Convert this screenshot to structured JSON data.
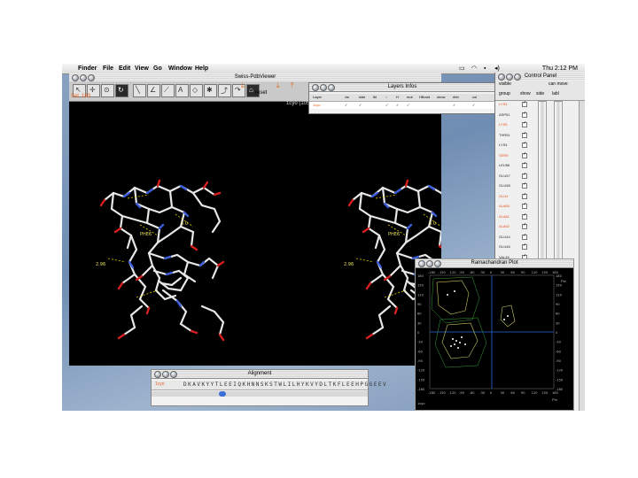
{
  "menubar": {
    "app": "Finder",
    "items": [
      "File",
      "Edit",
      "View",
      "Go",
      "Window",
      "Help"
    ],
    "clock": "Thu 2:12 PM"
  },
  "main_window": {
    "title": "Swiss-PdbViewer",
    "selection_label": "Sel. 183",
    "reset_label": "reset",
    "structure_title": "1cyo (1053 x 863)"
  },
  "layers_window": {
    "title": "Layers Infos",
    "columns": [
      "Layer",
      "vis",
      "side",
      "lbl",
      "::",
      "H",
      "mot",
      "HBond",
      "show",
      "ribb",
      "col"
    ],
    "row": [
      "1cyo",
      "✓",
      "✓",
      "",
      "✓",
      "✓",
      "✓",
      "",
      "",
      "✓",
      "✓"
    ]
  },
  "control_panel": {
    "title": "Control Panel",
    "group_label": "group",
    "visible_label": "visible",
    "can_move_label": "can move",
    "show_label": "show",
    "side_label": "side",
    "labl_label": "labl",
    "residues": [
      "LYS4",
      "ASP51",
      "LYS5",
      "THR51",
      "LYS4",
      "SER5",
      "LEU56",
      "GLU57",
      "GLU58",
      "GLU4",
      "ALA60",
      "ALA61",
      "ALA62",
      "GLU44",
      "GLU46",
      "VAL45",
      "ASN67",
      "GLU44",
      "ALA4",
      "GLY51",
      "GLU72",
      "ALA60",
      "ASP53",
      "LYS50",
      "THR65",
      "GLU4",
      "ASP57",
      "LYS58",
      "GLU59",
      "HIS39"
    ]
  },
  "ramachandran": {
    "title": "Ramachandran Plot",
    "x_ticks": [
      "-180",
      "-150",
      "-120",
      "-90",
      "-60",
      "-30",
      "0",
      "30",
      "60",
      "90",
      "120",
      "150",
      "180"
    ],
    "y_ticks": [
      "180",
      "150",
      "120",
      "90",
      "60",
      "30",
      "0",
      "-30",
      "-60",
      "-90",
      "-120",
      "-150",
      "-180"
    ],
    "psi_label": "Psi",
    "phi_label": "Phi",
    "corner_label": "1cyo"
  },
  "alignment": {
    "title": "Alignment",
    "row_label": "1cyo",
    "sequence": "DKAVKYYTLEEIQKHNNSKSTWLILHYKVYDLTKFLEEHPGGEEV"
  },
  "colors": {
    "residue_highlight": "#e8501a",
    "ramachandran_axes": "#2a6adf",
    "ramachandran_contour": "#c8c860",
    "thumb": "#3a6fd8"
  }
}
